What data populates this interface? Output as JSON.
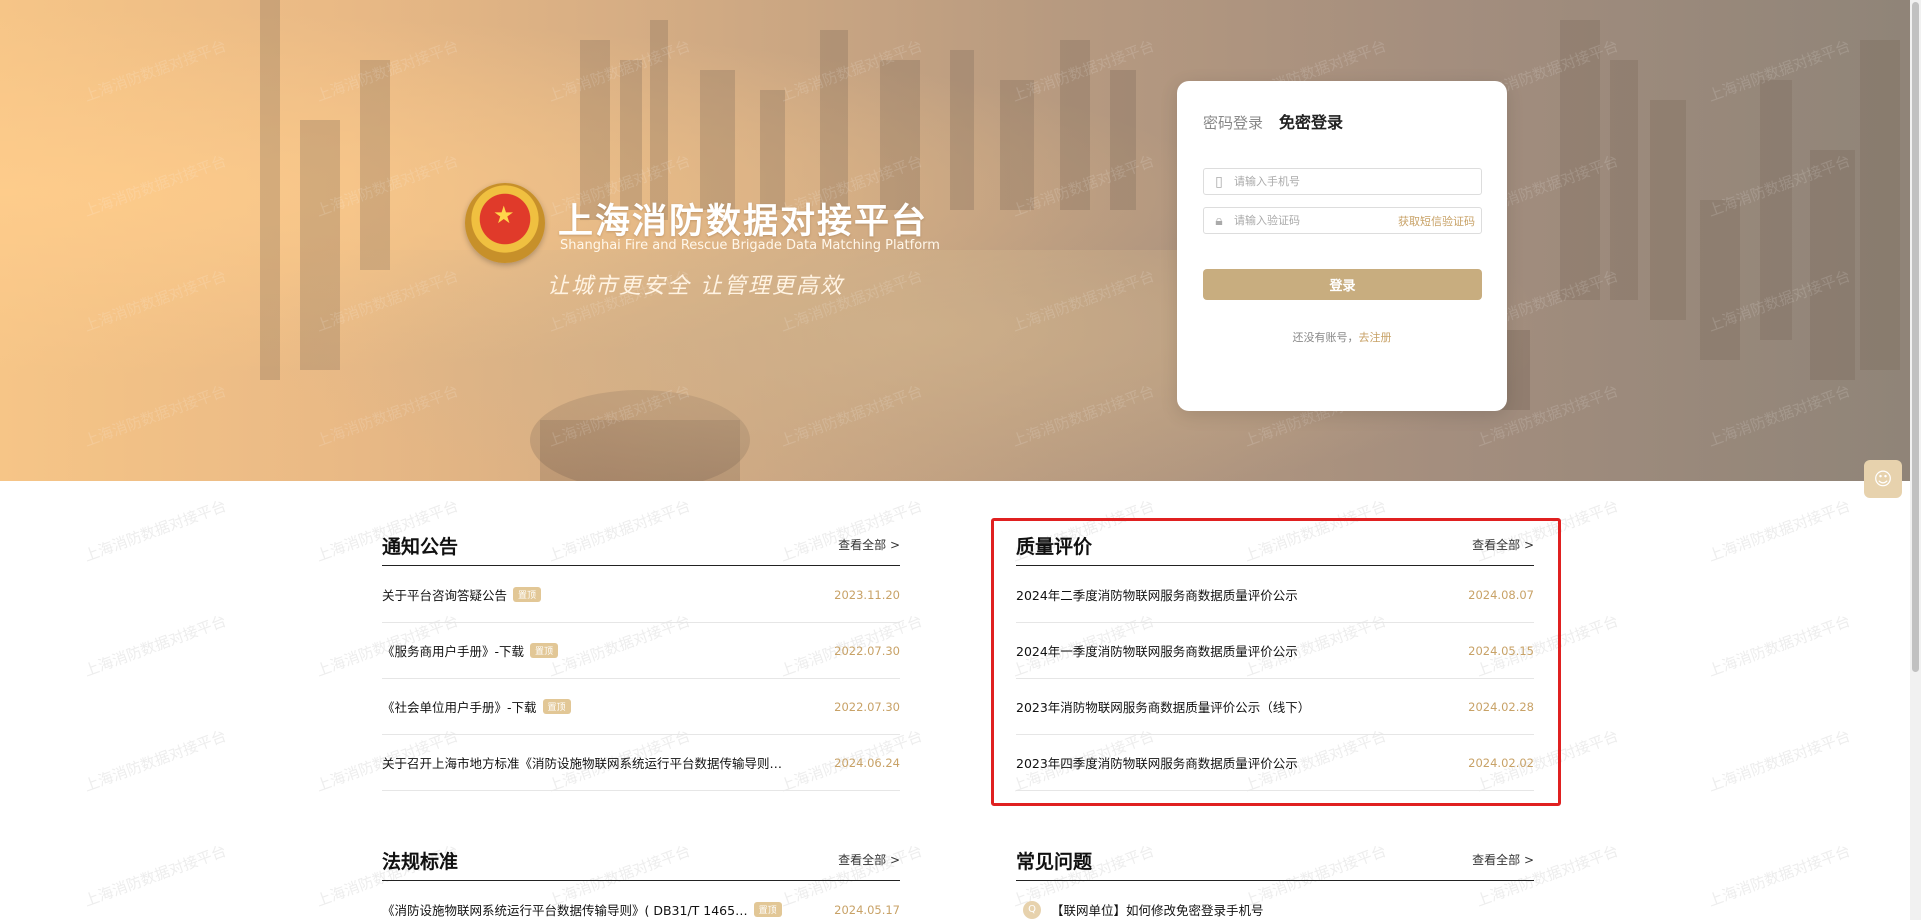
{
  "brand": {
    "title": "上海消防数据对接平台",
    "subtitle_en": "Shanghai Fire and Rescue Brigade Data Matching Platform",
    "slogan": "让城市更安全 让管理更高效"
  },
  "watermark_text": "上海消防数据对接平台",
  "login": {
    "tabs": [
      {
        "label": "密码登录",
        "active": false
      },
      {
        "label": "免密登录",
        "active": true
      }
    ],
    "phone_placeholder": "请输入手机号",
    "code_placeholder": "请输入验证码",
    "sms_link": "获取短信验证码",
    "submit_label": "登录",
    "register_prompt": "还没有账号，",
    "register_link": "去注册"
  },
  "notices": {
    "title": "通知公告",
    "more": "查看全部 >",
    "items": [
      {
        "text": "关于平台咨询答疑公告",
        "badge": "置顶",
        "date": "2023.11.20"
      },
      {
        "text": "《服务商用户手册》-下载",
        "badge": "置顶",
        "date": "2022.07.30"
      },
      {
        "text": "《社会单位用户手册》-下载",
        "badge": "置顶",
        "date": "2022.07.30"
      },
      {
        "text": "关于召开上海市地方标准《消防设施物联网系统运行平台数据传输导则…",
        "badge": "",
        "date": "2024.06.24"
      }
    ]
  },
  "quality": {
    "title": "质量评价",
    "more": "查看全部 >",
    "items": [
      {
        "text": "2024年二季度消防物联网服务商数据质量评价公示",
        "date": "2024.08.07"
      },
      {
        "text": "2024年一季度消防物联网服务商数据质量评价公示",
        "date": "2024.05.15"
      },
      {
        "text": "2023年消防物联网服务商数据质量评价公示（线下）",
        "date": "2024.02.28"
      },
      {
        "text": "2023年四季度消防物联网服务商数据质量评价公示",
        "date": "2024.02.02"
      }
    ]
  },
  "regulations": {
    "title": "法规标准",
    "more": "查看全部 >",
    "items": [
      {
        "text": "《消防设施物联网系统运行平台数据传输导则》( DB31/T 1465…",
        "badge": "置顶",
        "date": "2024.05.17"
      }
    ]
  },
  "faq": {
    "title": "常见问题",
    "more": "查看全部 >",
    "items": [
      {
        "icon": "Q",
        "text": "【联网单位】如何修改免密登录手机号"
      }
    ]
  },
  "colors": {
    "accent": "#c8a267",
    "button": "#c8ad7f",
    "highlight": "#e02020"
  }
}
